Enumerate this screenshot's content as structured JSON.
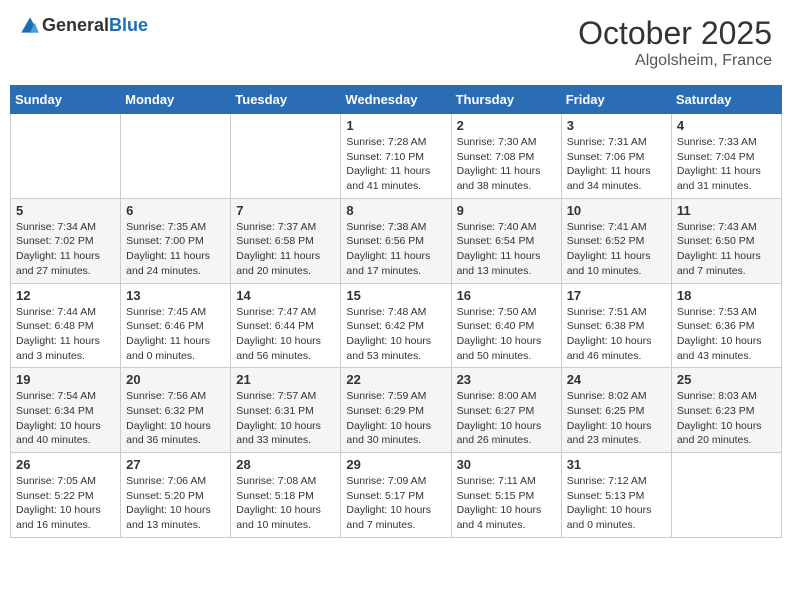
{
  "header": {
    "logo_general": "General",
    "logo_blue": "Blue",
    "month_title": "October 2025",
    "location": "Algolsheim, France"
  },
  "days_of_week": [
    "Sunday",
    "Monday",
    "Tuesday",
    "Wednesday",
    "Thursday",
    "Friday",
    "Saturday"
  ],
  "weeks": [
    [
      {
        "day": "",
        "info": ""
      },
      {
        "day": "",
        "info": ""
      },
      {
        "day": "",
        "info": ""
      },
      {
        "day": "1",
        "info": "Sunrise: 7:28 AM\nSunset: 7:10 PM\nDaylight: 11 hours\nand 41 minutes."
      },
      {
        "day": "2",
        "info": "Sunrise: 7:30 AM\nSunset: 7:08 PM\nDaylight: 11 hours\nand 38 minutes."
      },
      {
        "day": "3",
        "info": "Sunrise: 7:31 AM\nSunset: 7:06 PM\nDaylight: 11 hours\nand 34 minutes."
      },
      {
        "day": "4",
        "info": "Sunrise: 7:33 AM\nSunset: 7:04 PM\nDaylight: 11 hours\nand 31 minutes."
      }
    ],
    [
      {
        "day": "5",
        "info": "Sunrise: 7:34 AM\nSunset: 7:02 PM\nDaylight: 11 hours\nand 27 minutes."
      },
      {
        "day": "6",
        "info": "Sunrise: 7:35 AM\nSunset: 7:00 PM\nDaylight: 11 hours\nand 24 minutes."
      },
      {
        "day": "7",
        "info": "Sunrise: 7:37 AM\nSunset: 6:58 PM\nDaylight: 11 hours\nand 20 minutes."
      },
      {
        "day": "8",
        "info": "Sunrise: 7:38 AM\nSunset: 6:56 PM\nDaylight: 11 hours\nand 17 minutes."
      },
      {
        "day": "9",
        "info": "Sunrise: 7:40 AM\nSunset: 6:54 PM\nDaylight: 11 hours\nand 13 minutes."
      },
      {
        "day": "10",
        "info": "Sunrise: 7:41 AM\nSunset: 6:52 PM\nDaylight: 11 hours\nand 10 minutes."
      },
      {
        "day": "11",
        "info": "Sunrise: 7:43 AM\nSunset: 6:50 PM\nDaylight: 11 hours\nand 7 minutes."
      }
    ],
    [
      {
        "day": "12",
        "info": "Sunrise: 7:44 AM\nSunset: 6:48 PM\nDaylight: 11 hours\nand 3 minutes."
      },
      {
        "day": "13",
        "info": "Sunrise: 7:45 AM\nSunset: 6:46 PM\nDaylight: 11 hours\nand 0 minutes."
      },
      {
        "day": "14",
        "info": "Sunrise: 7:47 AM\nSunset: 6:44 PM\nDaylight: 10 hours\nand 56 minutes."
      },
      {
        "day": "15",
        "info": "Sunrise: 7:48 AM\nSunset: 6:42 PM\nDaylight: 10 hours\nand 53 minutes."
      },
      {
        "day": "16",
        "info": "Sunrise: 7:50 AM\nSunset: 6:40 PM\nDaylight: 10 hours\nand 50 minutes."
      },
      {
        "day": "17",
        "info": "Sunrise: 7:51 AM\nSunset: 6:38 PM\nDaylight: 10 hours\nand 46 minutes."
      },
      {
        "day": "18",
        "info": "Sunrise: 7:53 AM\nSunset: 6:36 PM\nDaylight: 10 hours\nand 43 minutes."
      }
    ],
    [
      {
        "day": "19",
        "info": "Sunrise: 7:54 AM\nSunset: 6:34 PM\nDaylight: 10 hours\nand 40 minutes."
      },
      {
        "day": "20",
        "info": "Sunrise: 7:56 AM\nSunset: 6:32 PM\nDaylight: 10 hours\nand 36 minutes."
      },
      {
        "day": "21",
        "info": "Sunrise: 7:57 AM\nSunset: 6:31 PM\nDaylight: 10 hours\nand 33 minutes."
      },
      {
        "day": "22",
        "info": "Sunrise: 7:59 AM\nSunset: 6:29 PM\nDaylight: 10 hours\nand 30 minutes."
      },
      {
        "day": "23",
        "info": "Sunrise: 8:00 AM\nSunset: 6:27 PM\nDaylight: 10 hours\nand 26 minutes."
      },
      {
        "day": "24",
        "info": "Sunrise: 8:02 AM\nSunset: 6:25 PM\nDaylight: 10 hours\nand 23 minutes."
      },
      {
        "day": "25",
        "info": "Sunrise: 8:03 AM\nSunset: 6:23 PM\nDaylight: 10 hours\nand 20 minutes."
      }
    ],
    [
      {
        "day": "26",
        "info": "Sunrise: 7:05 AM\nSunset: 5:22 PM\nDaylight: 10 hours\nand 16 minutes."
      },
      {
        "day": "27",
        "info": "Sunrise: 7:06 AM\nSunset: 5:20 PM\nDaylight: 10 hours\nand 13 minutes."
      },
      {
        "day": "28",
        "info": "Sunrise: 7:08 AM\nSunset: 5:18 PM\nDaylight: 10 hours\nand 10 minutes."
      },
      {
        "day": "29",
        "info": "Sunrise: 7:09 AM\nSunset: 5:17 PM\nDaylight: 10 hours\nand 7 minutes."
      },
      {
        "day": "30",
        "info": "Sunrise: 7:11 AM\nSunset: 5:15 PM\nDaylight: 10 hours\nand 4 minutes."
      },
      {
        "day": "31",
        "info": "Sunrise: 7:12 AM\nSunset: 5:13 PM\nDaylight: 10 hours\nand 0 minutes."
      },
      {
        "day": "",
        "info": ""
      }
    ]
  ]
}
